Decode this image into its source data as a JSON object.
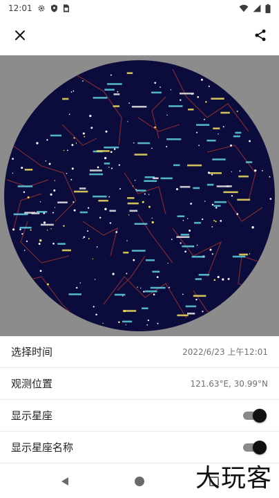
{
  "status_bar": {
    "time": "12:01"
  },
  "settings": {
    "select_time": {
      "label": "选择时间",
      "value": "2022/6/23 上午12:01"
    },
    "observe_location": {
      "label": "观测位置",
      "value": "121.63°E, 30.99°N"
    },
    "show_constellations": {
      "label": "显示星座",
      "enabled": true
    },
    "show_constellation_names": {
      "label": "显示星座名称",
      "enabled": true
    }
  },
  "watermark": {
    "text": "大玩客"
  },
  "colors": {
    "sky": "#0c0c3c",
    "constellation_lines": "#7a2a33",
    "star_labels": "#5fd0e0",
    "planet_labels": "#f0e060",
    "outer_bg": "#8c8c8c"
  }
}
